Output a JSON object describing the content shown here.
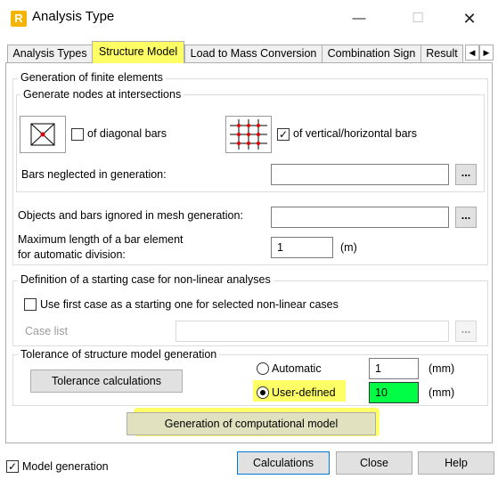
{
  "window": {
    "title": "Analysis Type",
    "app_icon_letter": "R",
    "controls": {
      "minimize": "—",
      "maximize": "☐",
      "close": "✕"
    }
  },
  "tabs": [
    {
      "label": "Analysis Types"
    },
    {
      "label": "Structure Model",
      "active": true
    },
    {
      "label": "Load to Mass Conversion"
    },
    {
      "label": "Combination Sign"
    },
    {
      "label": "Result"
    }
  ],
  "tab_scroll": {
    "left": "◀",
    "right": "▶"
  },
  "fe_group": {
    "legend": "Generation of finite elements",
    "nodes_group": {
      "legend": "Generate nodes at intersections",
      "diagonal_checkbox": {
        "label": "of diagonal bars",
        "checked": false
      },
      "vh_checkbox": {
        "label": "of vertical/horizontal bars",
        "checked": true
      },
      "bars_neglected": {
        "label": "Bars neglected in generation:",
        "value": "",
        "button": "..."
      }
    },
    "objects_ignored": {
      "label": "Objects and bars ignored in mesh generation:",
      "value": "",
      "button": "..."
    },
    "max_length": {
      "label_line1": "Maximum length of a bar element",
      "label_line2": "for automatic division:",
      "value": "1",
      "unit": "(m)"
    }
  },
  "nonlinear_group": {
    "legend": "Definition of a starting case for non-linear analyses",
    "use_first_case": {
      "label": "Use first case as a starting one for selected non-linear cases",
      "checked": false
    },
    "case_list": {
      "label": "Case list",
      "value": "",
      "button": "..."
    }
  },
  "tolerance_group": {
    "legend": "Tolerance of structure model generation",
    "calc_button": "Tolerance calculations",
    "automatic": {
      "label": "Automatic",
      "selected": false,
      "value": "1",
      "unit": "(mm)"
    },
    "user_defined": {
      "label": "User-defined",
      "selected": true,
      "value": "10",
      "unit": "(mm)"
    }
  },
  "generate_button": "Generation of computational model",
  "footer": {
    "model_generation": {
      "label": "Model generation",
      "checked": true
    },
    "buttons": {
      "calculations": "Calculations",
      "close": "Close",
      "help": "Help"
    }
  },
  "colors": {
    "highlight": "#ffff66",
    "green_field": "#00ff44",
    "focus_border": "#0078d7"
  }
}
